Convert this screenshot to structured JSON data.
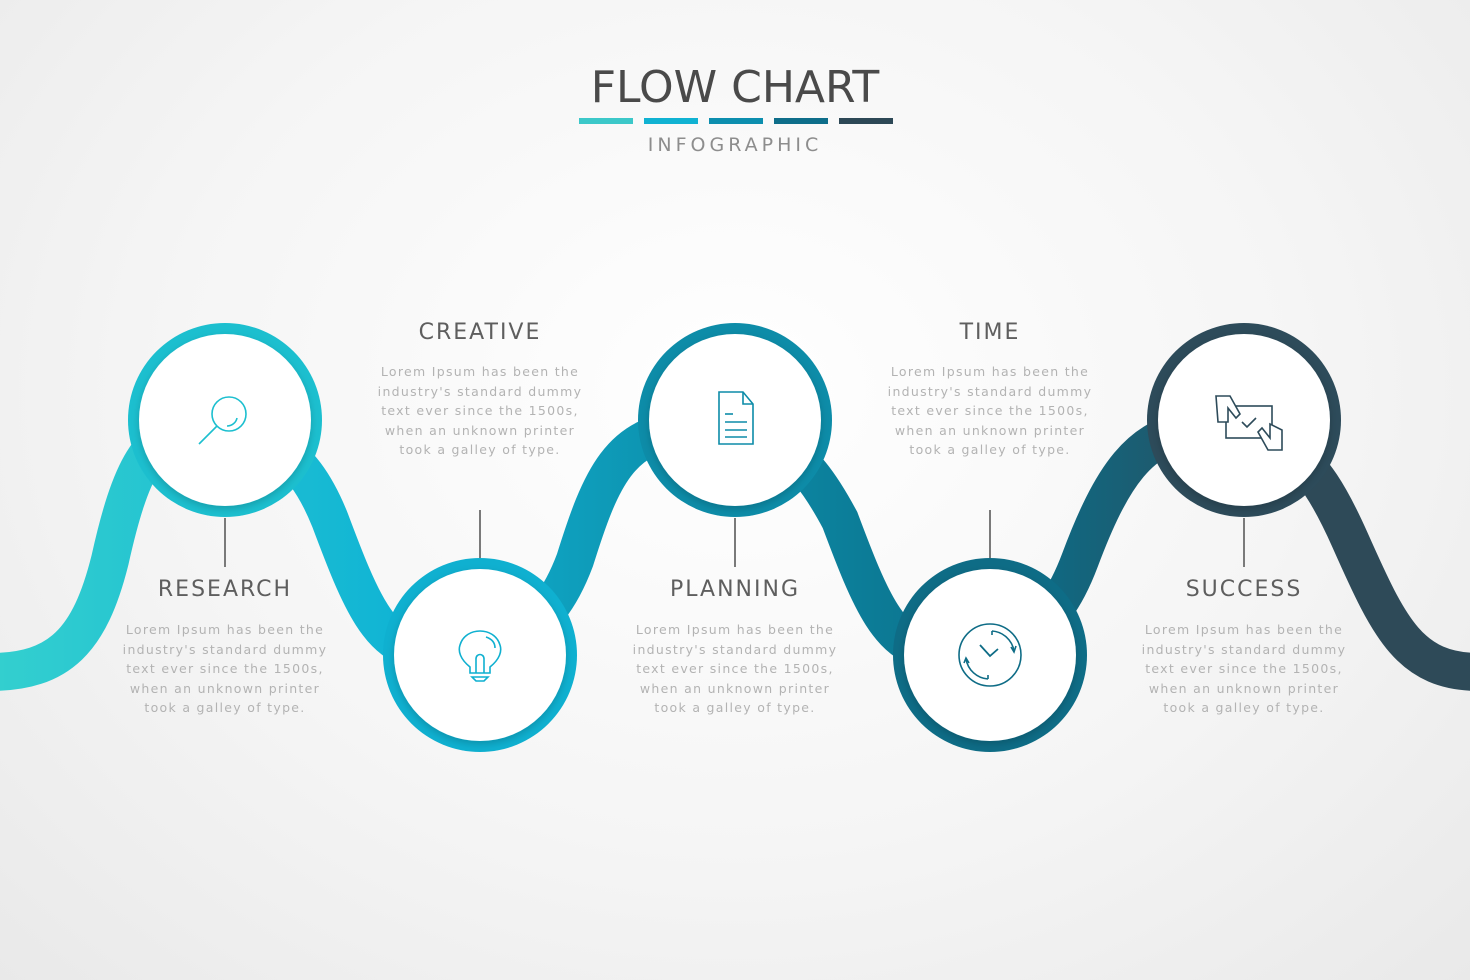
{
  "header": {
    "title": "FLOW CHART",
    "subtitle": "INFOGRAPHIC",
    "bar_colors": [
      "#3cc8c9",
      "#10b2d2",
      "#0c8eae",
      "#0e6e8a",
      "#2d4856"
    ]
  },
  "steps": [
    {
      "title": "RESEARCH",
      "icon": "magnifier-icon",
      "color": "#1cbfcf",
      "description": [
        "Lorem Ipsum has been the",
        "industry's standard dummy",
        "text ever since the 1500s,",
        "when an unknown printer",
        "took a galley of type."
      ]
    },
    {
      "title": "CREATIVE",
      "icon": "lightbulb-icon",
      "color": "#0fb0d0",
      "description": [
        "Lorem Ipsum has been the",
        "industry's standard dummy",
        "text ever since the 1500s,",
        "when an unknown printer",
        "took a galley of type."
      ]
    },
    {
      "title": "PLANNING",
      "icon": "document-icon",
      "color": "#0d8ca8",
      "description": [
        "Lorem Ipsum has been the",
        "industry's standard dummy",
        "text ever since the 1500s,",
        "when an unknown printer",
        "took a galley of type."
      ]
    },
    {
      "title": "TIME",
      "icon": "clock-cycle-icon",
      "color": "#0e6c86",
      "description": [
        "Lorem Ipsum has been the",
        "industry's standard dummy",
        "text ever since the 1500s,",
        "when an unknown printer",
        "took a galley of type."
      ]
    },
    {
      "title": "SUCCESS",
      "icon": "handshake-deal-icon",
      "color": "#2d4b5a",
      "description": [
        "Lorem Ipsum has been the",
        "industry's standard dummy",
        "text ever since the 1500s,",
        "when an unknown printer",
        "took a galley of type."
      ]
    }
  ],
  "gradient": [
    "#33cfcf",
    "#10b4d4",
    "#0c8aa6",
    "#0d6b85",
    "#2e4a58"
  ]
}
